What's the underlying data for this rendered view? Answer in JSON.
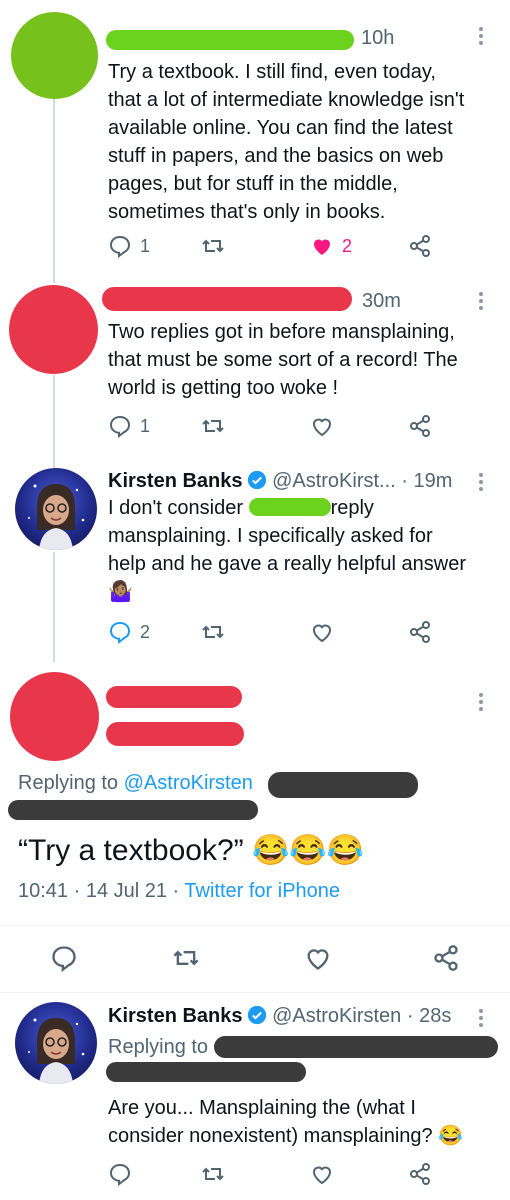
{
  "tweets": [
    {
      "time": "10h",
      "text_lines": [
        "Try a textbook. I still find, even today,",
        "that a lot of intermediate knowledge isn't",
        "available online. You can find the latest",
        "stuff in papers, and the basics on web",
        "pages, but for stuff in the middle,",
        "sometimes that's only in books."
      ],
      "reply_count": "1",
      "like_count": "2"
    },
    {
      "time": "30m",
      "text_lines": [
        "Two replies got in before mansplaining,",
        "that must be some sort of a record! The",
        "world is getting too woke !"
      ],
      "reply_count": "1"
    },
    {
      "name": "Kirsten Banks",
      "handle": "@AstroKirst...",
      "time": "· 19m",
      "text_line1_a": "I don't consider",
      "text_line1_b": "reply",
      "text_lines": [
        "mansplaining. I specifically asked for",
        "help and he gave a really helpful answer"
      ],
      "emoji": "🤷🏽‍♀️",
      "reply_count": "2"
    }
  ],
  "focused": {
    "replying_prefix": "Replying to",
    "replying_handle": "@AstroKirsten",
    "text": "“Try a textbook?”",
    "emojis": "😂😂😂",
    "timestamp": "10:41 · 14 Jul 21 ·",
    "source": "Twitter for iPhone"
  },
  "last_reply": {
    "name": "Kirsten Banks",
    "handle": "@AstroKirsten",
    "time": "· 28s",
    "replying_prefix": "Replying to",
    "text_lines": [
      "Are you... Mansplaining the (what I",
      "consider nonexistent) mansplaining?"
    ],
    "emoji": "😂"
  },
  "colors": {
    "like_red": "#f91880",
    "link_blue": "#1d9bf0",
    "verified_blue": "#1d9bf0",
    "muted": "#536471"
  },
  "icons": [
    "reply-icon",
    "retweet-icon",
    "like-icon",
    "share-icon",
    "more-icon",
    "verified-badge-icon"
  ]
}
